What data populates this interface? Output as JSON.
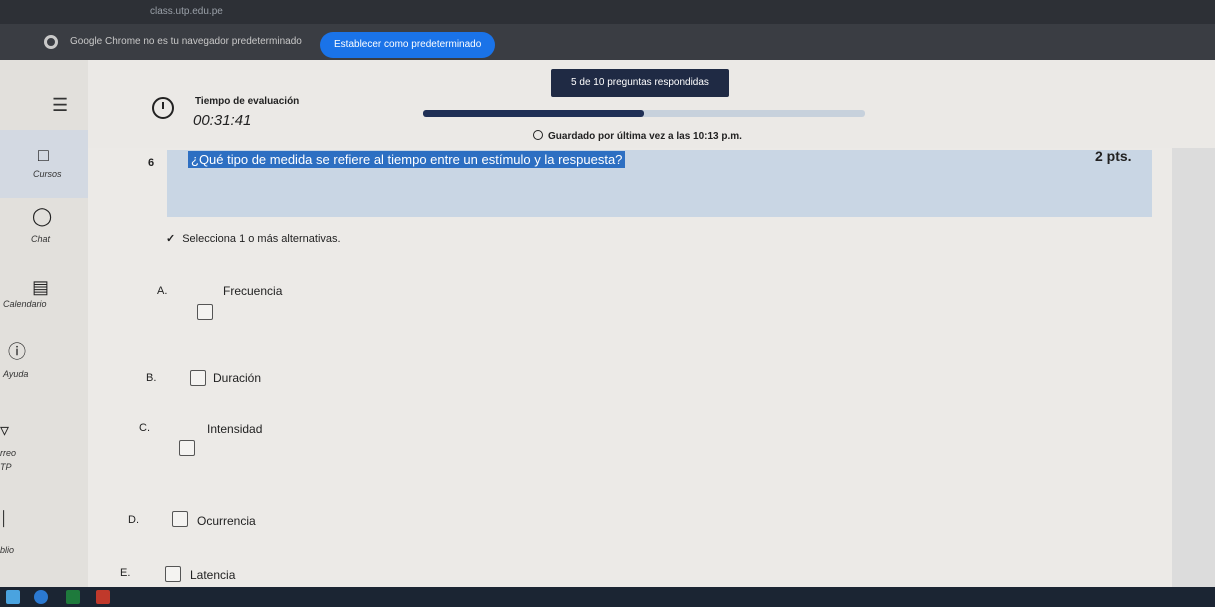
{
  "browser": {
    "url": "class.utp.edu.pe",
    "infobar_message": "Google Chrome no es tu navegador predeterminado",
    "set_default_label": "Establecer como predeterminado"
  },
  "sidebar": {
    "items": [
      {
        "label": "Cursos",
        "icon": "book-icon"
      },
      {
        "label": "Chat",
        "icon": "chat-icon"
      },
      {
        "label": "Calendario",
        "icon": "calendar-icon"
      },
      {
        "label": "Ayuda",
        "icon": "help-icon"
      },
      {
        "label": "rreo",
        "icon": "mail-icon"
      },
      {
        "label": "TP",
        "icon": ""
      },
      {
        "label": "blio",
        "icon": "library-icon"
      }
    ]
  },
  "header": {
    "timer_title": "Tiempo de evaluación",
    "timer_value": "00:31:41",
    "answered": "5 de 10 preguntas respondidas",
    "progress": 0.5,
    "saved_text": "Guardado por última vez a las 10:13 p.m."
  },
  "question": {
    "number": "6",
    "text": "¿Qué tipo de medida se refiere al tiempo entre un estímulo y la respuesta?",
    "points": "2 pts.",
    "instruction": "Selecciona 1 o más alternativas."
  },
  "options": [
    {
      "letter": "A.",
      "label": "Frecuencia"
    },
    {
      "letter": "B.",
      "label": "Duración"
    },
    {
      "letter": "C.",
      "label": "Intensidad"
    },
    {
      "letter": "D.",
      "label": "Ocurrencia"
    },
    {
      "letter": "E.",
      "label": "Latencia"
    }
  ],
  "colors": {
    "accent": "#1f2a44",
    "highlight": "#2d6fc2",
    "chrome_button": "#1a73e8"
  }
}
